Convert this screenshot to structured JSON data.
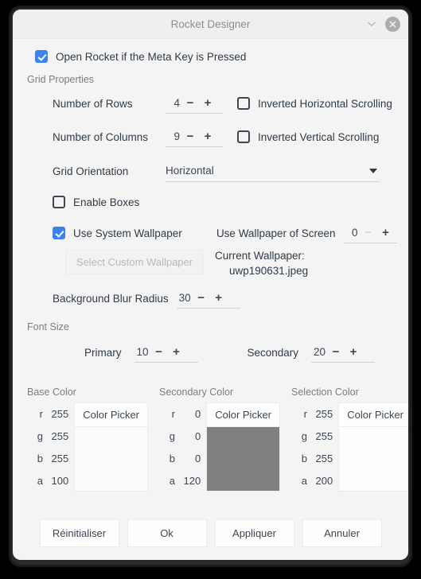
{
  "window": {
    "title": "Rocket Designer",
    "collapse_icon": "chevron-down-icon",
    "close_icon": "close-icon"
  },
  "meta_key": {
    "label": "Open Rocket if the Meta Key is Pressed",
    "checked": true
  },
  "grid": {
    "section_label": "Grid Properties",
    "rows_label": "Number of Rows",
    "rows_value": "4",
    "columns_label": "Number of Columns",
    "columns_value": "9",
    "inverted_horizontal_label": "Inverted Horizontal Scrolling",
    "inverted_vertical_label": "Inverted Vertical Scrolling",
    "orientation_label": "Grid Orientation",
    "orientation_value": "Horizontal",
    "enable_boxes_label": "Enable Boxes",
    "minus": "−",
    "plus": "+"
  },
  "wallpaper": {
    "use_system_label": "Use System Wallpaper",
    "select_custom_label": "Select Custom Wallpaper",
    "screen_label": "Use Wallpaper of Screen",
    "screen_value": "0",
    "current_label": "Current Wallpaper:",
    "current_value": "uwp190631.jpeg",
    "blur_label": "Background Blur Radius",
    "blur_value": "30"
  },
  "font_size": {
    "section_label": "Font Size",
    "primary_label": "Primary",
    "primary_value": "10",
    "secondary_label": "Secondary",
    "secondary_value": "20"
  },
  "colors": {
    "picker_label": "Color Picker",
    "groups": [
      {
        "title": "Base Color",
        "r_key": "r",
        "r_value": "255",
        "g_key": "g",
        "g_value": "255",
        "b_key": "b",
        "b_value": "255",
        "a_key": "a",
        "a_value": "100",
        "swatch_hex": "#fcfcfc"
      },
      {
        "title": "Secondary Color",
        "r_key": "r",
        "r_value": "0",
        "g_key": "g",
        "g_value": "0",
        "b_key": "b",
        "b_value": "0",
        "a_key": "a",
        "a_value": "120",
        "swatch_hex": "#807f7f"
      },
      {
        "title": "Selection Color",
        "r_key": "r",
        "r_value": "255",
        "g_key": "g",
        "g_value": "255",
        "b_key": "b",
        "b_value": "255",
        "a_key": "a",
        "a_value": "200",
        "swatch_hex": "#fdfdfd"
      }
    ]
  },
  "footer": {
    "reset_label": "Réinitialiser",
    "ok_label": "Ok",
    "apply_label": "Appliquer",
    "cancel_label": "Annuler"
  }
}
